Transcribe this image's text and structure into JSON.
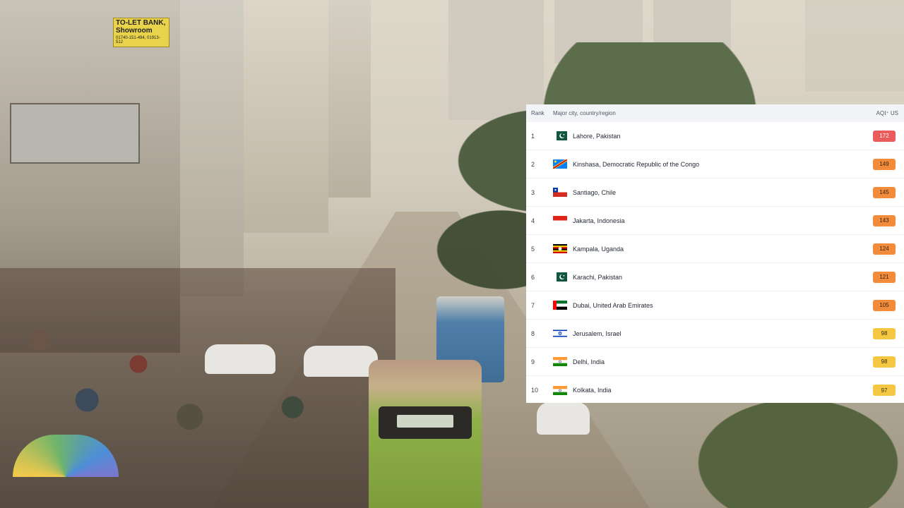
{
  "photo": {
    "description_icon": "hazy-street-photo",
    "sign_title": "TO-LET BANK, Showroom",
    "sign_phone": "01740-151-494, 01913-512"
  },
  "table": {
    "headers": {
      "rank": "Rank",
      "city": "Major city, country/region",
      "aqi": "AQI⁺ US"
    },
    "rows": [
      {
        "rank": "1",
        "city": "Lahore, Pakistan",
        "aqi": "172",
        "flag": "pakistan-flag-icon",
        "color": "#ea5b5b",
        "text": "#ffffff"
      },
      {
        "rank": "2",
        "city": "Kinshasa, Democratic Republic of the Congo",
        "aqi": "149",
        "flag": "dr-congo-flag-icon",
        "color": "#f28c3a",
        "text": "#3a2412"
      },
      {
        "rank": "3",
        "city": "Santiago, Chile",
        "aqi": "145",
        "flag": "chile-flag-icon",
        "color": "#f28c3a",
        "text": "#3a2412"
      },
      {
        "rank": "4",
        "city": "Jakarta, Indonesia",
        "aqi": "143",
        "flag": "indonesia-flag-icon",
        "color": "#f28c3a",
        "text": "#3a2412"
      },
      {
        "rank": "5",
        "city": "Kampala, Uganda",
        "aqi": "124",
        "flag": "uganda-flag-icon",
        "color": "#f28c3a",
        "text": "#3a2412"
      },
      {
        "rank": "6",
        "city": "Karachi, Pakistan",
        "aqi": "121",
        "flag": "pakistan-flag-icon",
        "color": "#f28c3a",
        "text": "#3a2412"
      },
      {
        "rank": "7",
        "city": "Dubai, United Arab Emirates",
        "aqi": "105",
        "flag": "uae-flag-icon",
        "color": "#f28c3a",
        "text": "#3a2412"
      },
      {
        "rank": "8",
        "city": "Jerusalem, Israel",
        "aqi": "98",
        "flag": "israel-flag-icon",
        "color": "#f5c742",
        "text": "#3a2f0c"
      },
      {
        "rank": "9",
        "city": "Delhi, India",
        "aqi": "98",
        "flag": "india-flag-icon",
        "color": "#f5c742",
        "text": "#3a2f0c"
      },
      {
        "rank": "10",
        "city": "Kolkata, India",
        "aqi": "97",
        "flag": "india-flag-icon",
        "color": "#f5c742",
        "text": "#3a2f0c"
      }
    ]
  }
}
